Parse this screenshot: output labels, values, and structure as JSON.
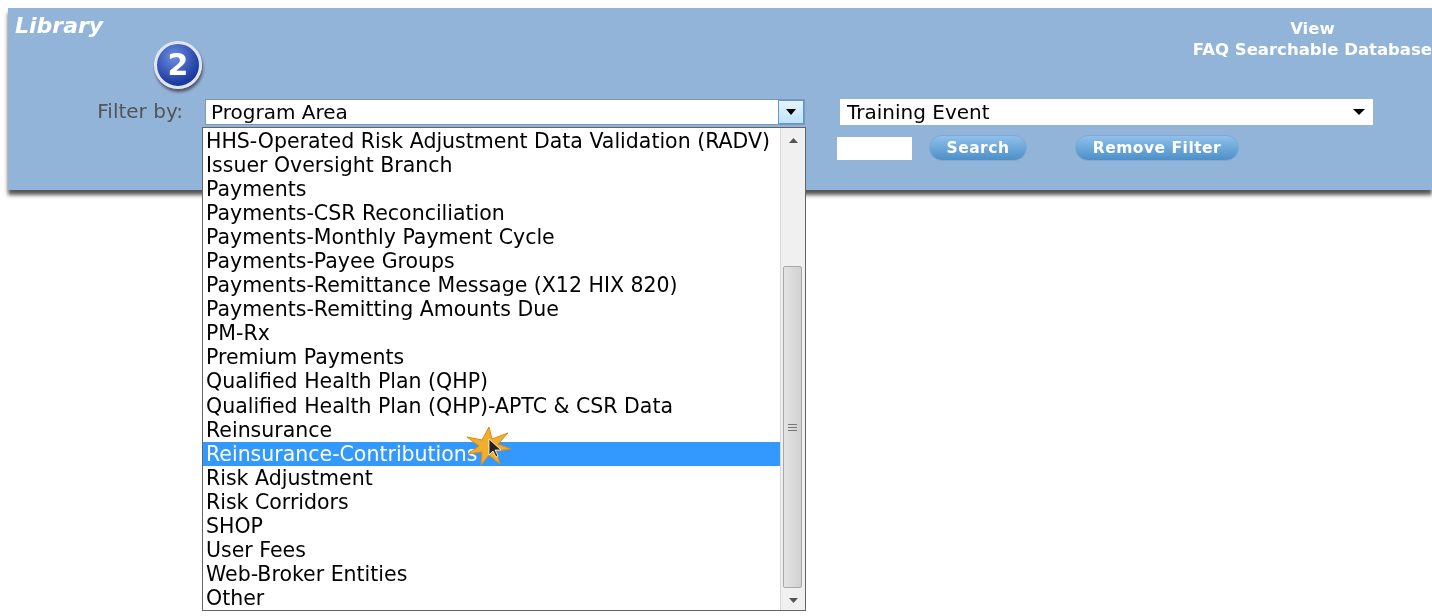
{
  "header": {
    "title": "Library",
    "step_badge": "2",
    "links": [
      "View",
      "FAQ Searchable Database"
    ]
  },
  "filter": {
    "label": "Filter by:",
    "program_area": {
      "value": "Program Area",
      "expanded": true,
      "options": [
        {
          "label": "HHS-Operated Risk Adjustment Data Validation (RADV)",
          "selected": false
        },
        {
          "label": "Issuer Oversight Branch",
          "selected": false
        },
        {
          "label": "Payments",
          "selected": false
        },
        {
          "label": "Payments-CSR Reconciliation",
          "selected": false
        },
        {
          "label": "Payments-Monthly Payment Cycle",
          "selected": false
        },
        {
          "label": "Payments-Payee Groups",
          "selected": false
        },
        {
          "label": "Payments-Remittance Message (X12 HIX 820)",
          "selected": false
        },
        {
          "label": "Payments-Remitting Amounts Due",
          "selected": false
        },
        {
          "label": "PM-Rx",
          "selected": false
        },
        {
          "label": "Premium Payments",
          "selected": false
        },
        {
          "label": "Qualified Health Plan (QHP)",
          "selected": false
        },
        {
          "label": "Qualified Health Plan (QHP)-APTC & CSR Data",
          "selected": false
        },
        {
          "label": "Reinsurance",
          "selected": false
        },
        {
          "label": "Reinsurance-Contributions",
          "selected": true
        },
        {
          "label": "Risk Adjustment",
          "selected": false
        },
        {
          "label": "Risk Corridors",
          "selected": false
        },
        {
          "label": "SHOP",
          "selected": false
        },
        {
          "label": "User Fees",
          "selected": false
        },
        {
          "label": "Web-Broker Entities",
          "selected": false
        },
        {
          "label": "Other",
          "selected": false
        }
      ]
    },
    "training_event": {
      "value": "Training Event"
    }
  },
  "buttons": [
    "Search",
    "Remove Filter"
  ]
}
